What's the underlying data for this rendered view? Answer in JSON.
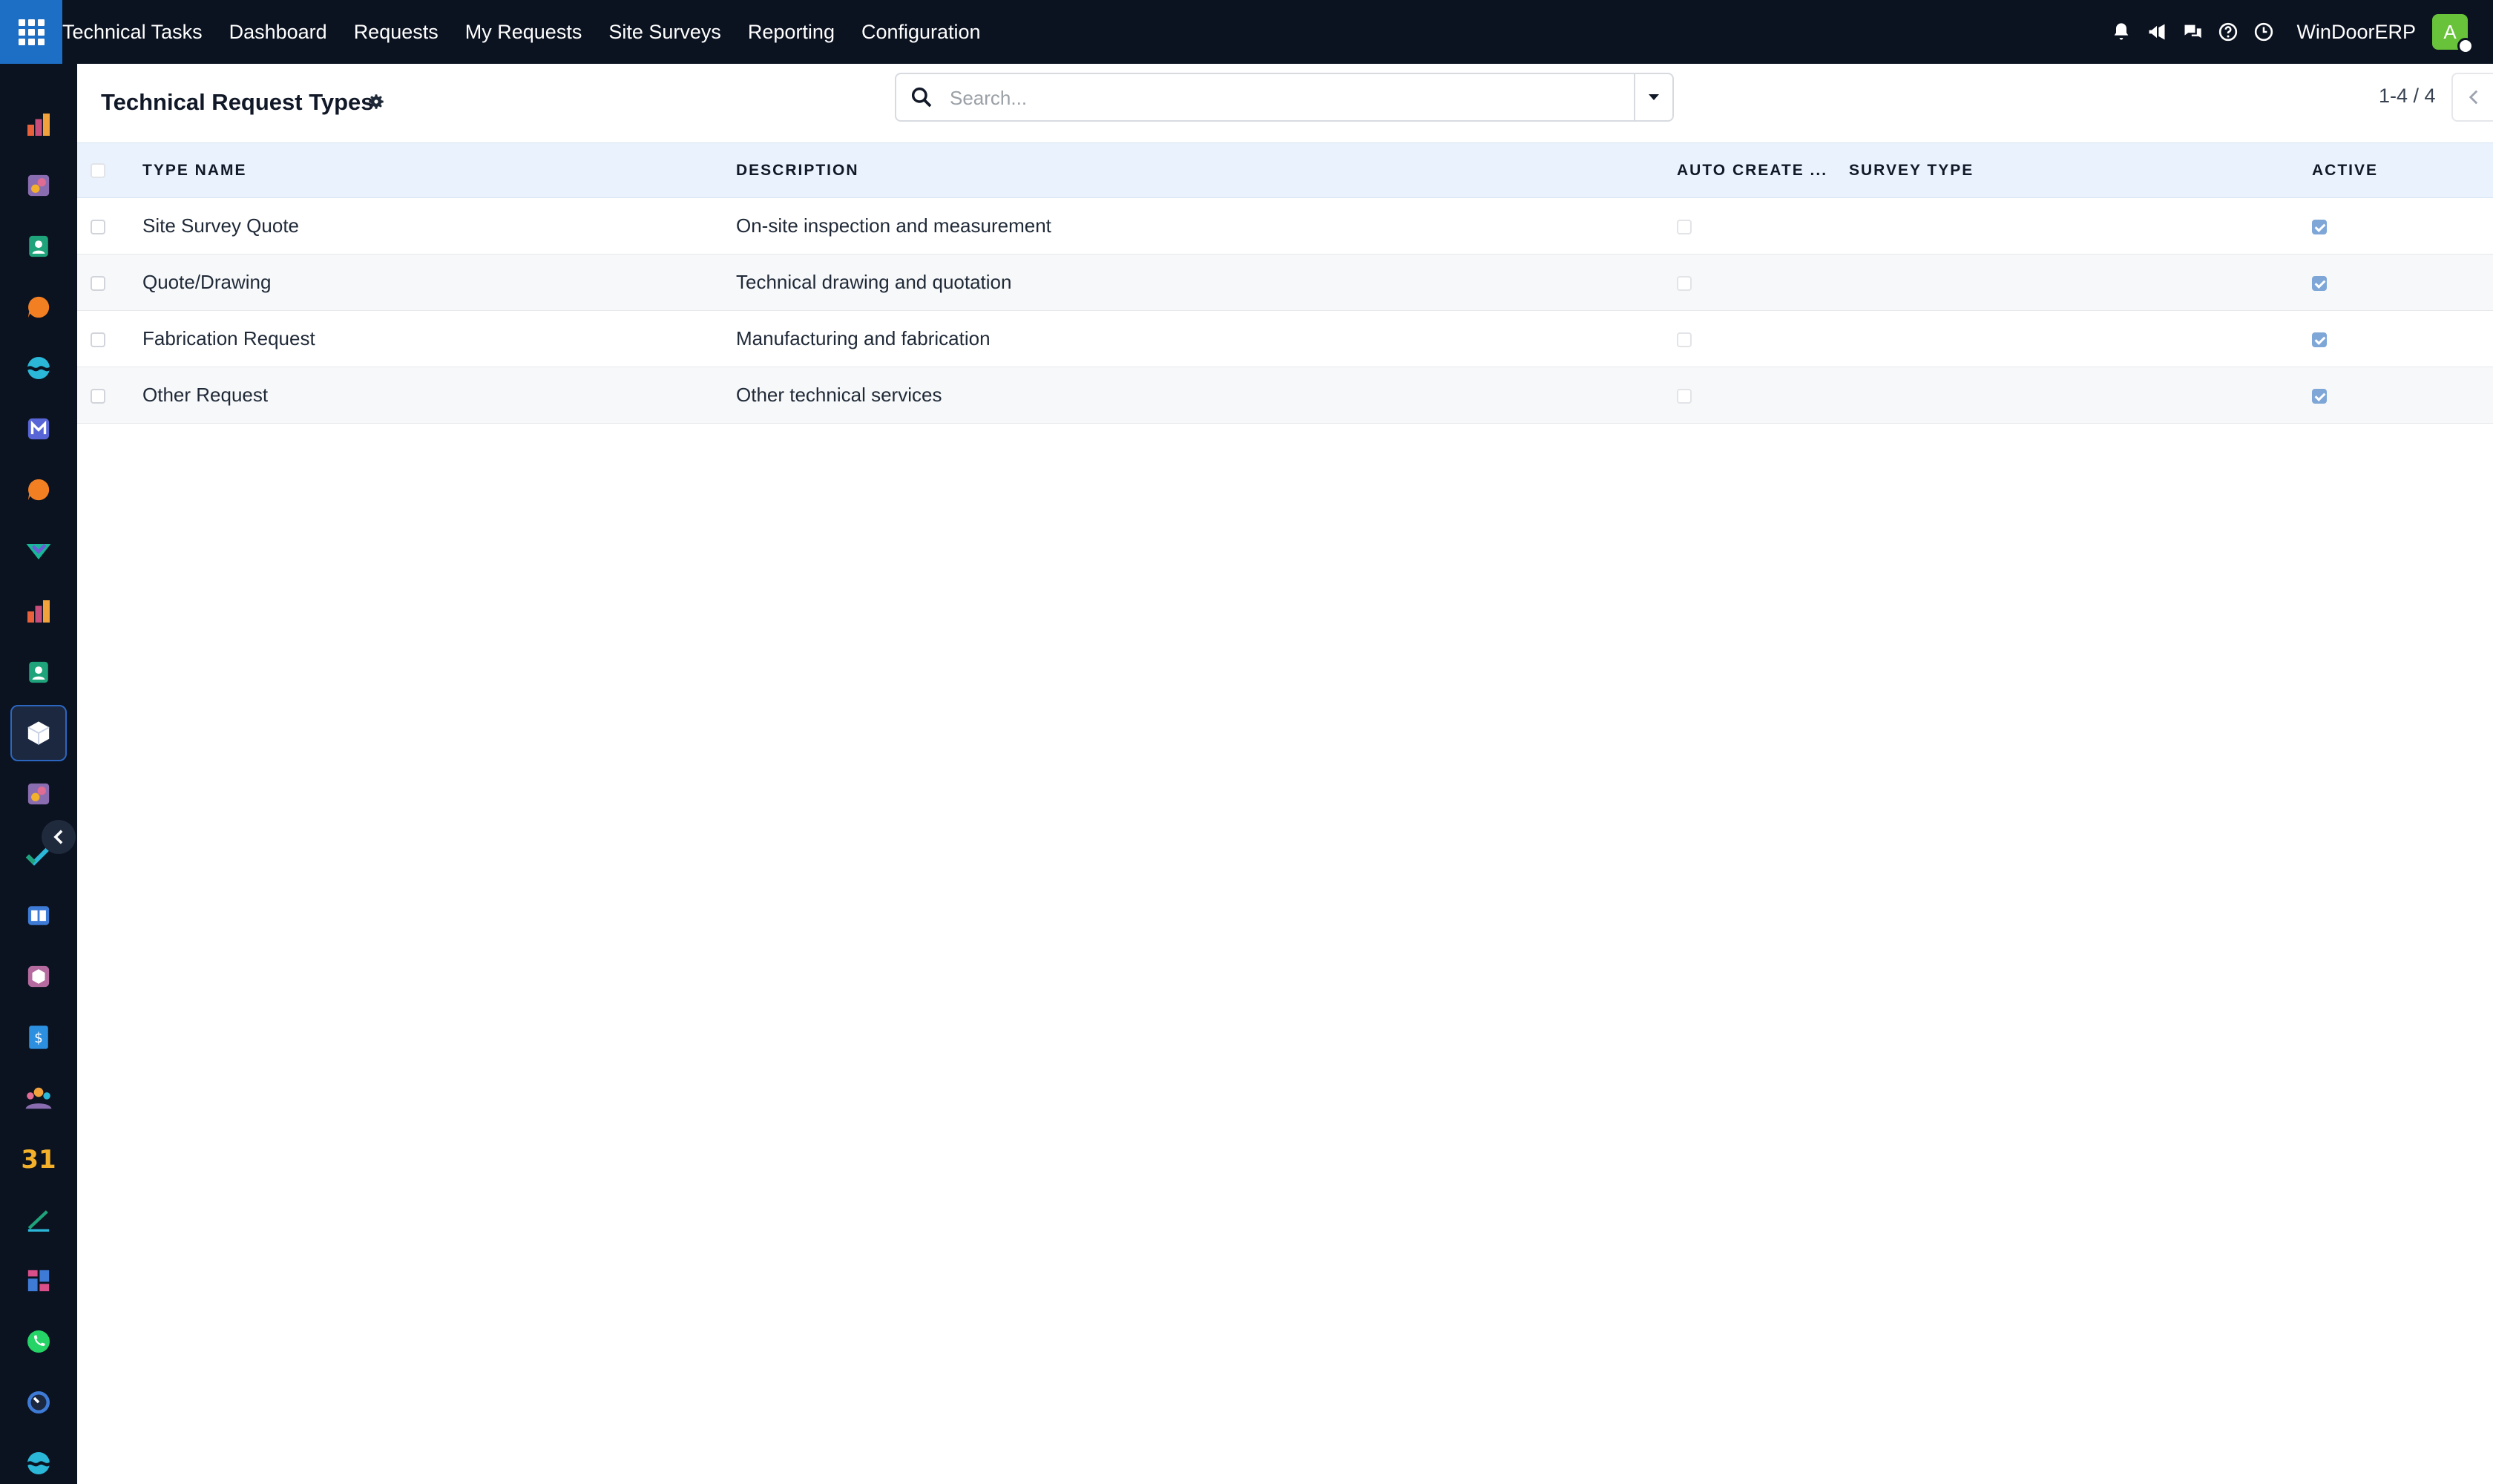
{
  "navbar": {
    "app_name": "Technical Tasks",
    "menu": [
      {
        "label": "Dashboard"
      },
      {
        "label": "Requests"
      },
      {
        "label": "My Requests"
      },
      {
        "label": "Site Surveys"
      },
      {
        "label": "Reporting"
      },
      {
        "label": "Configuration"
      }
    ],
    "company": "WinDoorERP",
    "avatar_initial": "A",
    "icons": [
      "bell-icon",
      "megaphone-icon",
      "chat-icon",
      "help-icon",
      "clock-icon"
    ]
  },
  "sidebar": {
    "items": [
      {
        "icon": "bar-chart-app-icon",
        "color": "#e8613a"
      },
      {
        "icon": "paint-app-icon",
        "color": "#c98bd8"
      },
      {
        "icon": "contacts-app-icon",
        "color": "#1fa37a"
      },
      {
        "icon": "chat-bubble-app-icon",
        "color": "#f27f22"
      },
      {
        "icon": "wave-app-icon",
        "color": "#2ab7d8"
      },
      {
        "icon": "mail-app-icon",
        "color": "#5865d6"
      },
      {
        "icon": "chat-bubble-app-icon",
        "color": "#f27f22"
      },
      {
        "icon": "check-ribbon-app-icon",
        "color": "#17b897"
      },
      {
        "icon": "bar-chart-app-icon",
        "color": "#e8613a"
      },
      {
        "icon": "contacts-app-icon",
        "color": "#1fa37a"
      },
      {
        "icon": "cube-app-icon",
        "color": "#ffffff",
        "active": true
      },
      {
        "icon": "paint-app-icon",
        "color": "#c98bd8"
      },
      {
        "icon": "checkmark-app-icon",
        "color": "#2ab7d8"
      },
      {
        "icon": "book-app-icon",
        "color": "#3e7bd6"
      },
      {
        "icon": "box-app-icon",
        "color": "#b56b9f"
      },
      {
        "icon": "invoice-app-icon",
        "color": "#2d8fe0"
      },
      {
        "icon": "team-app-icon",
        "color": "#f2a23a"
      },
      {
        "icon": "calendar-app-icon",
        "color": "#f2b02b",
        "text": "31"
      },
      {
        "icon": "sign-app-icon",
        "color": "#1fa37a"
      },
      {
        "icon": "dashboard-app-icon",
        "color": "#d94f8a"
      },
      {
        "icon": "whatsapp-app-icon",
        "color": "#25d366"
      },
      {
        "icon": "gauge-app-icon",
        "color": "#3e7bd6"
      },
      {
        "icon": "wave-app-icon",
        "color": "#2ab7d8"
      }
    ]
  },
  "control_panel": {
    "title": "Technical Request Types",
    "search_placeholder": "Search...",
    "pager": "1-4 / 4"
  },
  "table": {
    "columns": [
      "TYPE NAME",
      "DESCRIPTION",
      "AUTO CREATE ...",
      "SURVEY TYPE",
      "ACTIVE"
    ],
    "rows": [
      {
        "name": "Site Survey Quote",
        "description": "On-site inspection and measurement",
        "auto_create": false,
        "survey_type": "",
        "active": true
      },
      {
        "name": "Quote/Drawing",
        "description": "Technical drawing and quotation",
        "auto_create": false,
        "survey_type": "",
        "active": true
      },
      {
        "name": "Fabrication Request",
        "description": "Manufacturing and fabrication",
        "auto_create": false,
        "survey_type": "",
        "active": true
      },
      {
        "name": "Other Request",
        "description": "Other technical services",
        "auto_create": false,
        "survey_type": "",
        "active": true
      }
    ]
  }
}
